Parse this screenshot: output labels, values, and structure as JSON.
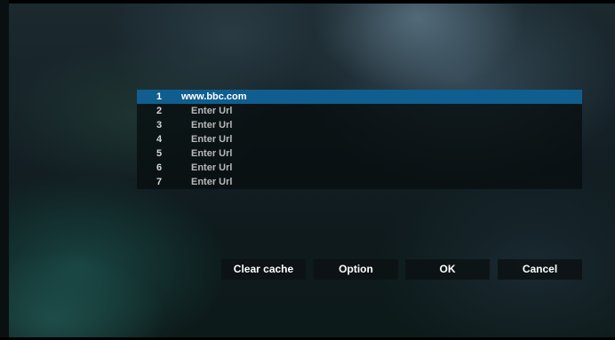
{
  "url_list": {
    "items": [
      {
        "index": "1",
        "text": "www.bbc.com",
        "selected": true
      },
      {
        "index": "2",
        "text": "Enter Url"
      },
      {
        "index": "3",
        "text": "Enter Url"
      },
      {
        "index": "4",
        "text": "Enter Url"
      },
      {
        "index": "5",
        "text": "Enter Url"
      },
      {
        "index": "6",
        "text": "Enter Url"
      },
      {
        "index": "7",
        "text": "Enter Url"
      }
    ],
    "selected_color": "#0f5e8f"
  },
  "buttons": {
    "clear_cache": "Clear cache",
    "option": "Option",
    "ok": "OK",
    "cancel": "Cancel"
  }
}
